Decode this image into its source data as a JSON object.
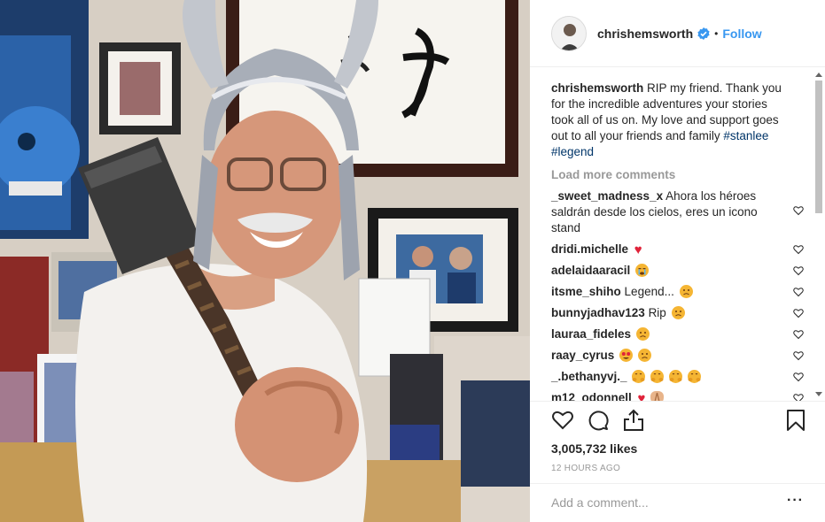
{
  "post": {
    "image_alt": "Man wearing a silver winged helmet holding a hammer in an office",
    "username": "chrishemsworth",
    "follow_label": "Follow",
    "separator": "•",
    "caption_user": "chrishemsworth",
    "caption_text": "RIP my friend. Thank you for the incredible adventures your stories took all of us on. My love and support goes out to all your friends and family",
    "caption_tags": [
      "#stanlee",
      "#legend"
    ],
    "load_more": "Load more comments",
    "likes": "3,005,732 likes",
    "time": "12 HOURS AGO",
    "comment_placeholder": "Add a comment...",
    "more_icon": "···"
  },
  "comments": [
    {
      "user": "_sweet_madness_x",
      "text": "Ahora los héroes saldrán desde los cielos, eres un icono stand",
      "emoji": []
    },
    {
      "user": "dridi.michelle",
      "text": "",
      "emoji": [
        "red-heart"
      ]
    },
    {
      "user": "adelaidaaracil",
      "text": "",
      "emoji": [
        "crying-face"
      ]
    },
    {
      "user": "itsme_shiho",
      "text": "Legend...",
      "emoji": [
        "sad-face"
      ]
    },
    {
      "user": "bunnyjadhav123",
      "text": "Rip",
      "emoji": [
        "sad-face"
      ]
    },
    {
      "user": "lauraa_fideles",
      "text": "",
      "emoji": [
        "sad-face"
      ]
    },
    {
      "user": "raay_cyrus",
      "text": "",
      "emoji": [
        "star-eyes-face",
        "sad-face"
      ]
    },
    {
      "user": "_.bethanyvj._",
      "text": "",
      "emoji": [
        "hugging-face",
        "hugging-face",
        "hugging-face",
        "hugging-face"
      ]
    },
    {
      "user": "m12_odonnell",
      "text": "",
      "emoji": [
        "red-heart",
        "praying-face"
      ]
    }
  ],
  "colors": {
    "link_blue": "#3897f0",
    "hashtag": "#003569",
    "muted": "#999999",
    "heart_red": "#e0233a"
  }
}
